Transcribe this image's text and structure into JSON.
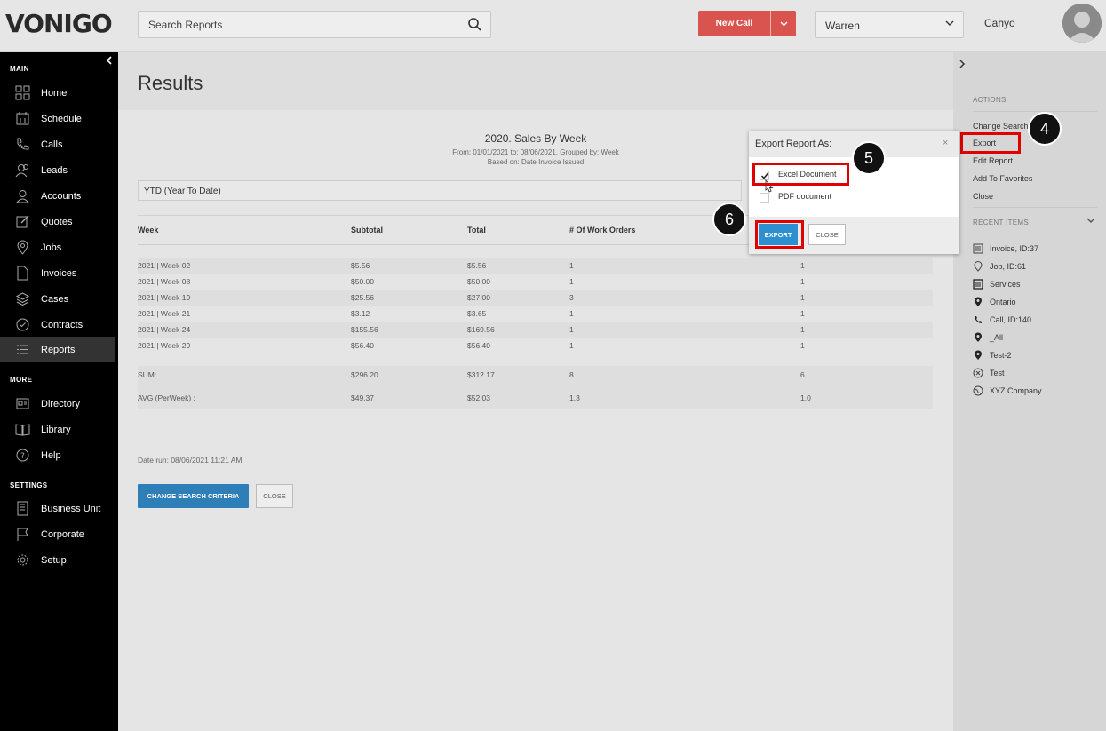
{
  "app": {
    "logo": "VONIGO"
  },
  "header": {
    "search_placeholder": "Search Reports",
    "new_call_label": "New Call",
    "user_select": "Warren",
    "username": "Cahyo"
  },
  "sidebar": {
    "main_label": "MAIN",
    "more_label": "MORE",
    "settings_label": "SETTINGS",
    "main_items": [
      {
        "label": "Home",
        "icon": "home-icon"
      },
      {
        "label": "Schedule",
        "icon": "calendar-icon"
      },
      {
        "label": "Calls",
        "icon": "phone-icon"
      },
      {
        "label": "Leads",
        "icon": "users-icon"
      },
      {
        "label": "Accounts",
        "icon": "user-icon"
      },
      {
        "label": "Quotes",
        "icon": "edit-icon"
      },
      {
        "label": "Jobs",
        "icon": "pin-icon"
      },
      {
        "label": "Invoices",
        "icon": "file-icon"
      },
      {
        "label": "Cases",
        "icon": "layers-icon"
      },
      {
        "label": "Contracts",
        "icon": "check-circle-icon"
      },
      {
        "label": "Reports",
        "icon": "list-icon"
      }
    ],
    "more_items": [
      {
        "label": "Directory",
        "icon": "directory-icon"
      },
      {
        "label": "Library",
        "icon": "book-icon"
      },
      {
        "label": "Help",
        "icon": "help-icon"
      }
    ],
    "settings_items": [
      {
        "label": "Business Unit",
        "icon": "building-icon"
      },
      {
        "label": "Corporate",
        "icon": "flag-icon"
      },
      {
        "label": "Setup",
        "icon": "gear-icon"
      }
    ]
  },
  "main": {
    "page_title": "Results",
    "report_title": "2020. Sales By Week",
    "report_subtitle": "From: 01/01/2021 to: 08/06/2021, Grouped by: Week",
    "report_basis": "Based on: Date Invoice Issued",
    "ytd_label": "YTD (Year To Date)",
    "columns": [
      "Week",
      "Subtotal",
      "Total",
      "# Of Work Orders",
      ""
    ],
    "rows": [
      [
        "2021 | Week 02",
        "$5.56",
        "$5.56",
        "1",
        "1"
      ],
      [
        "2021 | Week 08",
        "$50.00",
        "$50.00",
        "1",
        "1"
      ],
      [
        "2021 | Week 19",
        "$25.56",
        "$27.00",
        "3",
        "1"
      ],
      [
        "2021 | Week 21",
        "$3.12",
        "$3.65",
        "1",
        "1"
      ],
      [
        "2021 | Week 24",
        "$155.56",
        "$169.56",
        "1",
        "1"
      ],
      [
        "2021 | Week 29",
        "$56.40",
        "$56.40",
        "1",
        "1"
      ]
    ],
    "sum_row": [
      "SUM:",
      "$296.20",
      "$312.17",
      "8",
      "6"
    ],
    "avg_row": [
      "AVG (PerWeek) :",
      "$49.37",
      "$52.03",
      "1.3",
      "1.0"
    ],
    "date_run": "Date run: 08/06/2021 11:21 AM",
    "change_search_btn": "CHANGE SEARCH CRITERIA",
    "close_btn": "CLOSE"
  },
  "modal": {
    "title": "Export Report As:",
    "close_glyph": "×",
    "options": [
      {
        "label": "Excel Document",
        "checked": true
      },
      {
        "label": "PDF document",
        "checked": false
      }
    ],
    "export_btn": "EXPORT",
    "close_btn": "CLOSE"
  },
  "right_panel": {
    "actions_label": "ACTIONS",
    "actions": [
      "Change Search",
      "Export",
      "Edit Report",
      "Add To Favorites",
      "Close"
    ],
    "recent_label": "RECENT ITEMS",
    "recent_items": [
      {
        "label": "Invoice, ID:37",
        "icon": "invoice-icon"
      },
      {
        "label": "Job, ID:61",
        "icon": "pin-icon"
      },
      {
        "label": "Services",
        "icon": "list-box-icon"
      },
      {
        "label": "Ontario",
        "icon": "location-icon"
      },
      {
        "label": "Call, ID:140",
        "icon": "phone-icon"
      },
      {
        "label": "_All",
        "icon": "location-icon"
      },
      {
        "label": "Test-2",
        "icon": "location-icon"
      },
      {
        "label": "Test",
        "icon": "x-circle-icon"
      },
      {
        "label": "XYZ Company",
        "icon": "globe-icon"
      }
    ]
  },
  "annotations": {
    "step4": "4",
    "step5": "5",
    "step6": "6"
  },
  "colors": {
    "new_call": "#d9534f",
    "primary_button": "#2e7eb8",
    "highlight": "#e00000",
    "sidebar": "#000000"
  }
}
